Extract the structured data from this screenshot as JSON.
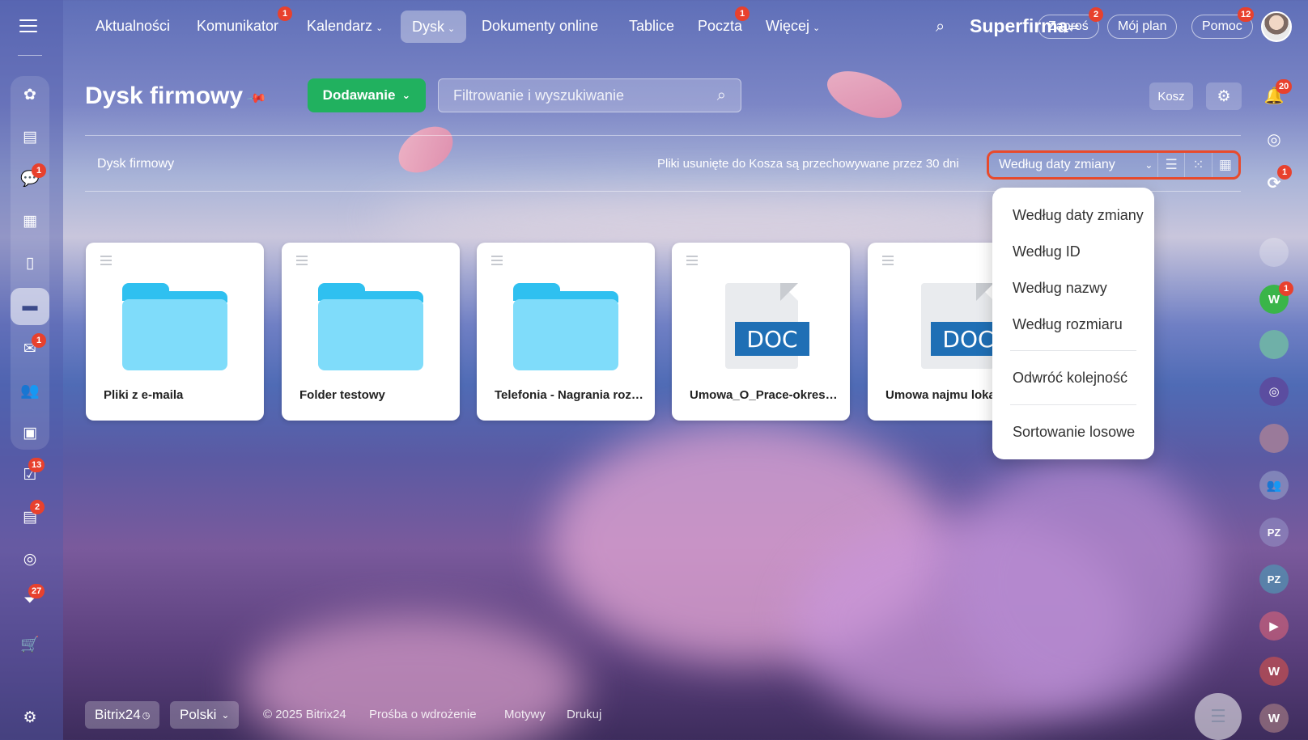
{
  "topnav": {
    "items": [
      {
        "label": "Aktualności",
        "badge": ""
      },
      {
        "label": "Komunikator",
        "badge": "1"
      },
      {
        "label": "Kalendarz",
        "badge": ""
      },
      {
        "label": "Dysk",
        "badge": ""
      },
      {
        "label": "Dokumenty online",
        "badge": ""
      },
      {
        "label": "Tablice",
        "badge": ""
      },
      {
        "label": "Poczta",
        "badge": "1"
      },
      {
        "label": "Więcej",
        "badge": ""
      }
    ],
    "brand": "Superfirma",
    "invite_label": "Zaproś",
    "invite_badge": "2",
    "plan_label": "Mój plan",
    "help_label": "Pomoc",
    "help_badge": "12"
  },
  "sidebar": {
    "badges": {
      "chat": "1",
      "mail": "1",
      "tasks": "13",
      "crm": "2",
      "funnels": "27"
    }
  },
  "header": {
    "title": "Dysk firmowy",
    "add_label": "Dodawanie",
    "filter_placeholder": "Filtrowanie i wyszukiwanie",
    "trash_label": "Kosz",
    "notifications_badge": "20"
  },
  "toolbar": {
    "breadcrumb": "Dysk firmowy",
    "retention_note": "Pliki usunięte do Kosza są przechowywane przez 30 dni",
    "sort_label": "Według daty zmiany"
  },
  "files": [
    {
      "name": "Pliki z e-maila",
      "type": "folder"
    },
    {
      "name": "Folder testowy",
      "type": "folder"
    },
    {
      "name": "Telefonia - Nagrania rozmów",
      "type": "folder"
    },
    {
      "name": "Umowa_O_Prace-okres-próbny",
      "type": "doc",
      "ext": "DOC"
    },
    {
      "name": "Umowa najmu lokalu",
      "type": "doc",
      "ext": "DOC"
    }
  ],
  "sort_menu": {
    "items": [
      "Według daty zmiany",
      "Według ID",
      "Według nazwy",
      "Według rozmiaru"
    ],
    "reverse": "Odwróć kolejność",
    "random": "Sortowanie losowe"
  },
  "right_rail": {
    "chat_badge": "1",
    "user_w_badge": "1",
    "initials": [
      "W",
      "PZ",
      "PZ",
      "W",
      "W"
    ]
  },
  "footer": {
    "brand": "Bitrix24",
    "language": "Polski",
    "copyright": "© 2025 Bitrix24",
    "links": [
      "Prośba o wdrożenie",
      "Motywy",
      "Drukuj"
    ]
  },
  "colors": {
    "accent_green": "#21b15f",
    "badge_red": "#e8412d",
    "doc_blue": "#1f6fb5",
    "folder_blue": "#2fc0f0",
    "highlight_red": "#e84a2c"
  }
}
